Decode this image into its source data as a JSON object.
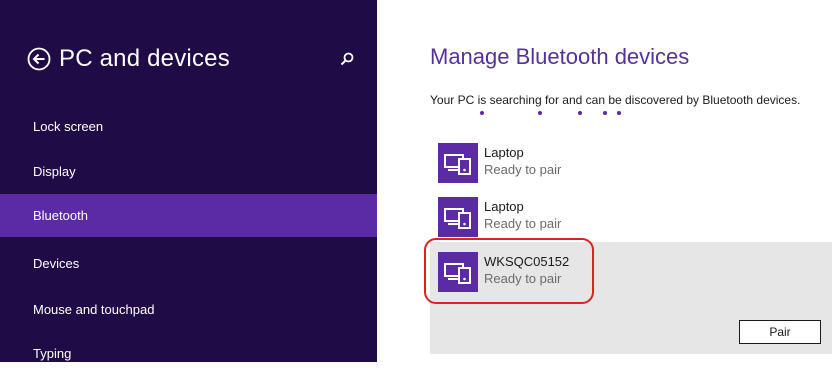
{
  "sidebar": {
    "title": "PC and devices",
    "back_icon": "back-arrow-icon",
    "search_icon": "search-icon",
    "items": [
      {
        "label": "Lock screen",
        "selected": false
      },
      {
        "label": "Display",
        "selected": false
      },
      {
        "label": "Bluetooth",
        "selected": true
      },
      {
        "label": "Devices",
        "selected": false
      },
      {
        "label": "Mouse and touchpad",
        "selected": false
      },
      {
        "label": "Typing",
        "selected": false
      }
    ]
  },
  "main": {
    "title": "Manage Bluetooth devices",
    "status": "Your PC is searching for and can be discovered by Bluetooth devices.",
    "devices": [
      {
        "name": "Laptop",
        "status": "Ready to pair",
        "icon": "pc-phone-device-icon"
      },
      {
        "name": "Laptop",
        "status": "Ready to pair",
        "icon": "pc-phone-device-icon"
      },
      {
        "name": "WKSQC05152",
        "status": "Ready to pair",
        "icon": "pc-phone-device-icon",
        "selected": true
      }
    ],
    "pair_button_label": "Pair"
  },
  "colors": {
    "sidebar_bg": "#1f0c47",
    "sidebar_selected": "#5b2ba6",
    "accent": "#5b2ba6",
    "title_text": "#55329b",
    "highlight_bg": "#e6e6e6",
    "annotation_ring": "#e0201f"
  }
}
